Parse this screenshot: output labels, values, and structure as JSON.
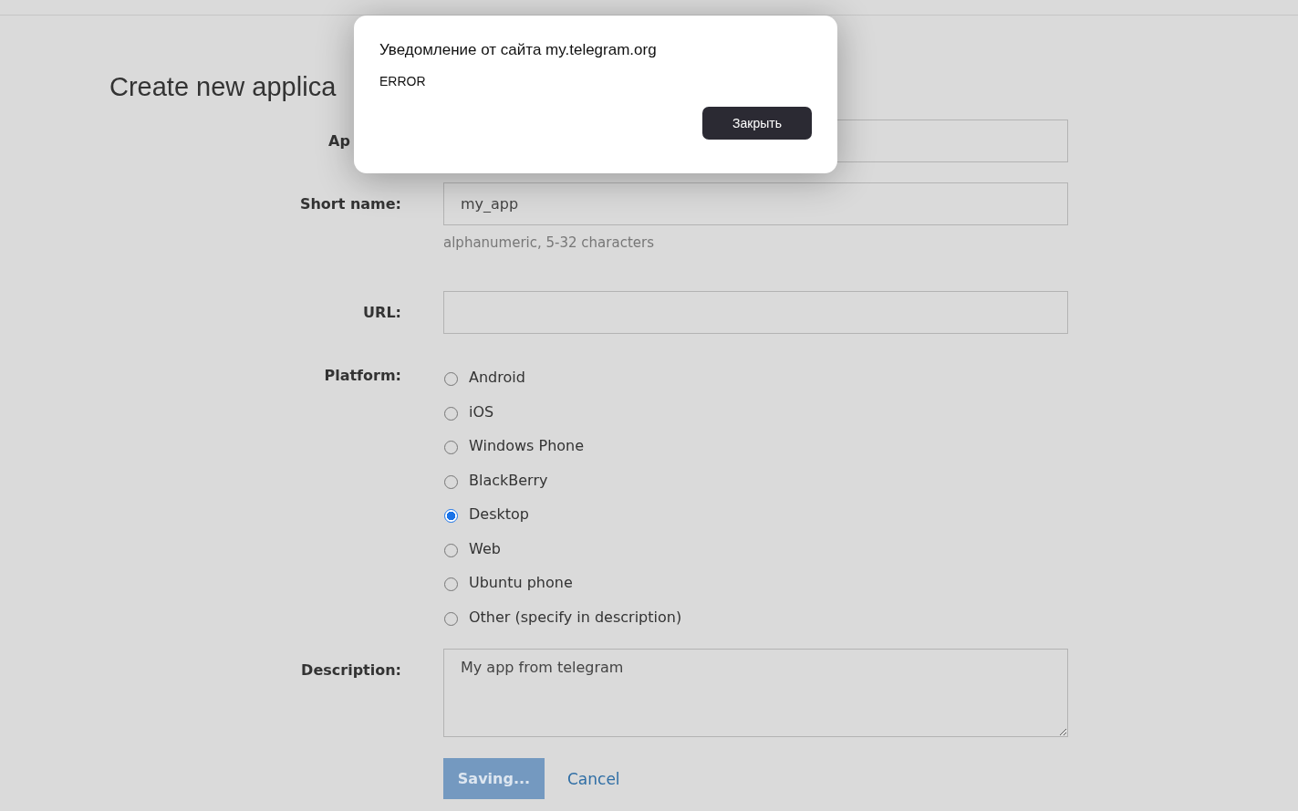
{
  "page": {
    "title": "Create new applica"
  },
  "fields": [
    {
      "kind": "text",
      "label": "Ap",
      "clipped": true
    },
    {
      "kind": "text",
      "label": "Short name:",
      "value": "my_app",
      "hint": "alphanumeric, 5-32 characters"
    },
    {
      "kind": "text",
      "label": "URL:"
    },
    {
      "kind": "radio",
      "label": "Platform:",
      "options": [
        {
          "label": "Android",
          "selected": false
        },
        {
          "label": "iOS",
          "selected": false
        },
        {
          "label": "Windows Phone",
          "selected": false
        },
        {
          "label": "BlackBerry",
          "selected": false
        },
        {
          "label": "Desktop",
          "selected": true
        },
        {
          "label": "Web",
          "selected": false
        },
        {
          "label": "Ubuntu phone",
          "selected": false
        },
        {
          "label": "Other (specify in description)",
          "selected": false
        }
      ]
    },
    {
      "kind": "textarea",
      "label": "Description:",
      "value": "My app from telegram"
    }
  ],
  "actions": {
    "save": {
      "label": "Saving...",
      "disabled": true
    },
    "cancel": {
      "label": "Cancel"
    }
  },
  "dialog": {
    "title": "Уведомление от сайта my.telegram.org",
    "message": "ERROR",
    "button": "Закрыть"
  }
}
